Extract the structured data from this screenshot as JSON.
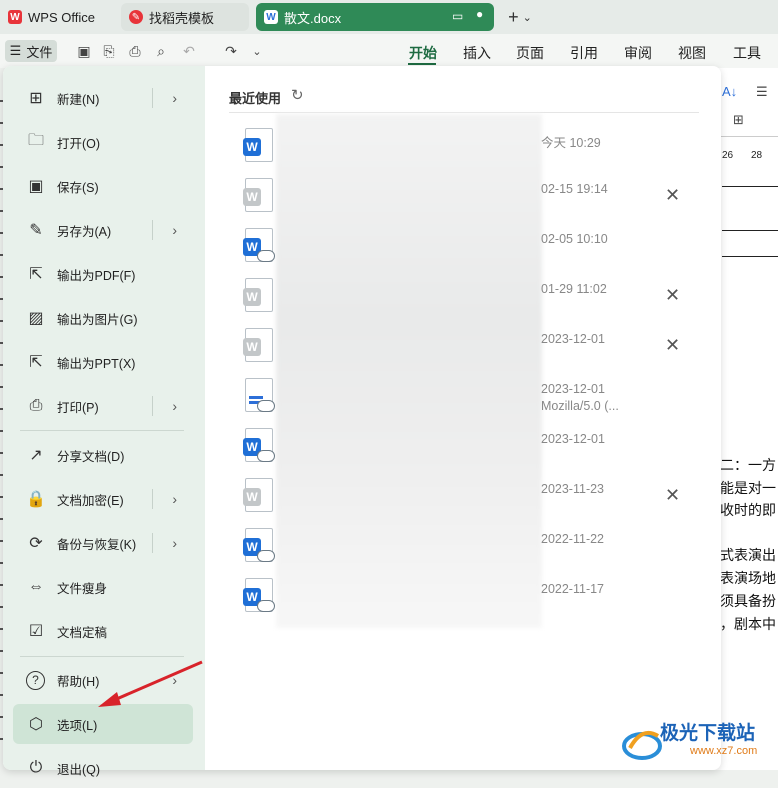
{
  "tabs": [
    {
      "label": "WPS Office"
    },
    {
      "label": "找稻壳模板"
    },
    {
      "label": "散文.docx"
    }
  ],
  "toolbar": {
    "file_menu": "文件",
    "ribbon_tabs": [
      "开始",
      "插入",
      "页面",
      "引用",
      "审阅",
      "视图",
      "工具"
    ]
  },
  "nav": {
    "items": [
      {
        "label": "新建(N)",
        "icon": "plus-doc-icon",
        "submenu": true
      },
      {
        "label": "打开(O)",
        "icon": "folder-icon",
        "submenu": false
      },
      {
        "label": "保存(S)",
        "icon": "save-icon",
        "submenu": false
      },
      {
        "label": "另存为(A)",
        "icon": "save-as-icon",
        "submenu": true
      },
      {
        "label": "输出为PDF(F)",
        "icon": "pdf-export-icon",
        "submenu": false
      },
      {
        "label": "输出为图片(G)",
        "icon": "image-export-icon",
        "submenu": false
      },
      {
        "label": "输出为PPT(X)",
        "icon": "ppt-export-icon",
        "submenu": false
      },
      {
        "label": "打印(P)",
        "icon": "printer-icon",
        "submenu": true
      },
      {
        "label": "分享文档(D)",
        "icon": "share-icon",
        "submenu": false
      },
      {
        "label": "文档加密(E)",
        "icon": "lock-doc-icon",
        "submenu": true
      },
      {
        "label": "备份与恢复(K)",
        "icon": "backup-icon",
        "submenu": true
      },
      {
        "label": "文件瘦身",
        "icon": "slim-icon",
        "submenu": false
      },
      {
        "label": "文档定稿",
        "icon": "finalize-icon",
        "submenu": false
      },
      {
        "label": "帮助(H)",
        "icon": "help-icon",
        "submenu": true
      },
      {
        "label": "选项(L)",
        "icon": "gear-icon",
        "submenu": false
      },
      {
        "label": "退出(Q)",
        "icon": "exit-icon",
        "submenu": false
      }
    ]
  },
  "recent": {
    "title": "最近使用",
    "files": [
      {
        "time": "今天 10:29",
        "color": "#1f6fd6",
        "cloud": false,
        "closable": false
      },
      {
        "time": "02-15 19:14",
        "color": "#c3c7c9",
        "cloud": false,
        "closable": true
      },
      {
        "time": "02-05 10:10",
        "color": "#1f6fd6",
        "cloud": true,
        "closable": false
      },
      {
        "time": "01-29 11:02",
        "color": "#c3c7c9",
        "cloud": false,
        "closable": true
      },
      {
        "time": "2023-12-01",
        "color": "#c3c7c9",
        "cloud": false,
        "closable": true
      },
      {
        "time": "2023-12-01",
        "sub": "Mozilla/5.0 (...",
        "color": "doc",
        "cloud": true,
        "closable": false
      },
      {
        "time": "2023-12-01",
        "color": "#1f6fd6",
        "cloud": true,
        "closable": false
      },
      {
        "time": "2023-11-23",
        "color": "#c3c7c9",
        "cloud": false,
        "closable": true
      },
      {
        "time": "2022-11-22",
        "color": "#1f6fd6",
        "cloud": true,
        "closable": false
      },
      {
        "time": "2022-11-17",
        "color": "#1f6fd6",
        "cloud": true,
        "closable": false
      }
    ]
  },
  "document": {
    "ruler": [
      "26",
      "28"
    ],
    "lines": [
      "二：一方",
      "能是对一",
      "收时的即",
      "式表演出",
      "表演场地",
      "须具备扮",
      "，剧本中"
    ]
  },
  "watermark": {
    "brand": "极光下载站",
    "url": "www.xz7.com"
  }
}
